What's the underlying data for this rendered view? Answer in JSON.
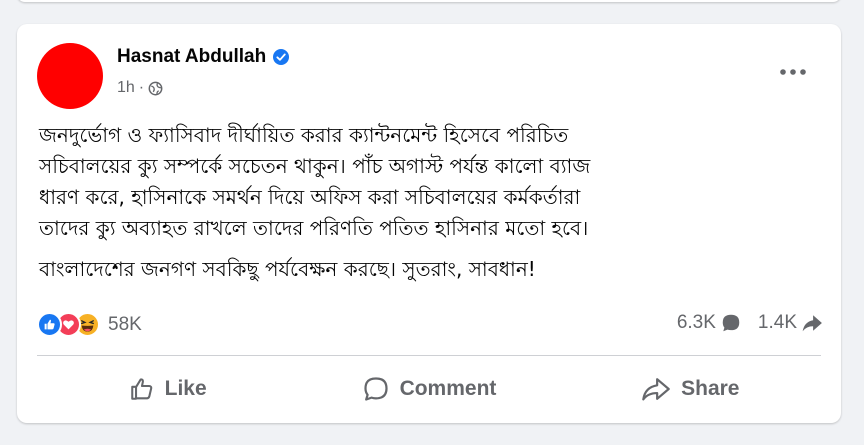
{
  "post": {
    "author": "Hasnat Abdullah",
    "time": "1h",
    "separator": "·",
    "avatar_color": "#ff0000",
    "verified_color": "#1877f2",
    "text_lines_1": [
      "জনদুর্ভোগ ও ফ্যাসিবাদ দীর্ঘায়িত করার ক্যান্টনমেন্ট হিসেবে পরিচিত",
      "সচিবালয়ের ক্যু সম্পর্কে সচেতন থাকুন। পাঁচ অগাস্ট পর্যন্ত কালো ব্যাজ",
      "ধারণ করে, হাসিনাকে সমর্থন দিয়ে অফিস করা সচিবালয়ের কর্মকর্তারা",
      "তাদের ক্যু অব্যাহত রাখলে তাদের পরিণতি  পতিত হাসিনার মতো হবে।"
    ],
    "text_line_2": "বাংলাদেশের জনগণ সবকিছু পর্যবেক্ষন করছে। সুতরাং, সাবধান!"
  },
  "reactions": {
    "types": [
      "like",
      "love",
      "haha"
    ],
    "count": "58K"
  },
  "stats": {
    "comments": "6.3K",
    "shares": "1.4K"
  },
  "actions": {
    "like": "Like",
    "comment": "Comment",
    "share": "Share"
  },
  "icons": {
    "more": "more-horizontal-icon",
    "privacy": "globe-icon",
    "verified": "verified-badge-icon",
    "comment_stat": "comment-bubble-icon",
    "share_stat": "share-arrow-icon"
  },
  "colors": {
    "background": "#f0f2f5",
    "card": "#ffffff",
    "muted_text": "#65676b",
    "like_blue": "#1877f2",
    "love_red": "#f33e58",
    "haha_yellow": "#f7b125"
  }
}
